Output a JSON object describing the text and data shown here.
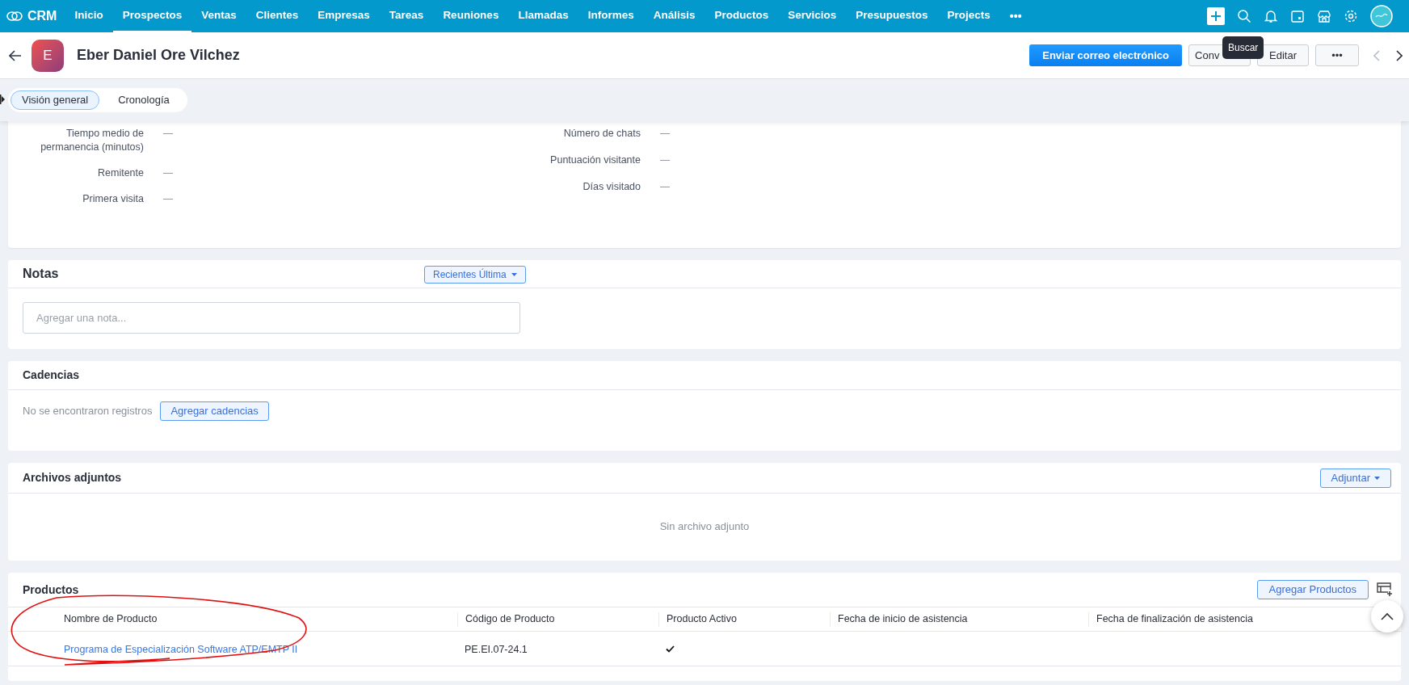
{
  "top_nav": {
    "logo": "CRM",
    "items": [
      {
        "label": "Inicio",
        "selected": false
      },
      {
        "label": "Prospectos",
        "selected": true
      },
      {
        "label": "Ventas",
        "selected": false
      },
      {
        "label": "Clientes",
        "selected": false
      },
      {
        "label": "Empresas",
        "selected": false
      },
      {
        "label": "Tareas",
        "selected": false
      },
      {
        "label": "Reuniones",
        "selected": false
      },
      {
        "label": "Llamadas",
        "selected": false
      },
      {
        "label": "Informes",
        "selected": false
      },
      {
        "label": "Análisis",
        "selected": false
      },
      {
        "label": "Productos",
        "selected": false
      },
      {
        "label": "Servicios",
        "selected": false
      },
      {
        "label": "Presupuestos",
        "selected": false
      },
      {
        "label": "Projects",
        "selected": false
      }
    ],
    "more": "•••"
  },
  "record_header": {
    "avatar_letter": "E",
    "name": "Eber Daniel Ore Vilchez",
    "buttons": [
      {
        "label": "Enviar correo electrónico",
        "kind": "primary"
      },
      {
        "label": "Conv",
        "kind": "covered"
      },
      {
        "label": "Editar",
        "kind": "secondary"
      },
      {
        "label": "•••",
        "kind": "secondary"
      }
    ],
    "prev_disabled": true,
    "next_disabled": false
  },
  "tooltip": "Buscar",
  "view_tabs": [
    {
      "label": "Visión general",
      "selected": true
    },
    {
      "label": "Cronología",
      "selected": false
    }
  ],
  "fields_left": [
    {
      "label": "Tiempo medio de permanencia (minutos)",
      "value": "—"
    },
    {
      "label": "Remitente",
      "value": "—"
    },
    {
      "label": "Primera visita",
      "value": "—"
    }
  ],
  "fields_right": [
    {
      "label": "Número de chats",
      "value": "—"
    },
    {
      "label": "Puntuación visitante",
      "value": "—"
    },
    {
      "label": "Días visitado",
      "value": "—"
    }
  ],
  "notes": {
    "title": "Notas",
    "sort": "Recientes Última",
    "placeholder": "Agregar una nota..."
  },
  "cadences": {
    "title": "Cadencias",
    "empty": "No se encontraron registros",
    "button": "Agregar cadencias"
  },
  "attachments": {
    "title": "Archivos adjuntos",
    "button": "Adjuntar",
    "empty": "Sin archivo adjunto"
  },
  "products": {
    "title": "Productos",
    "button": "Agregar Productos",
    "columns": [
      "Nombre de Producto",
      "Código de Producto",
      "Producto Activo",
      "Fecha de inicio de asistencia",
      "Fecha de finalización de asistencia"
    ],
    "rows": [
      {
        "name": "Programa de Especialización Software ATP/EMTP II",
        "code": "PE.EI.07-24.1",
        "active": true
      }
    ]
  }
}
